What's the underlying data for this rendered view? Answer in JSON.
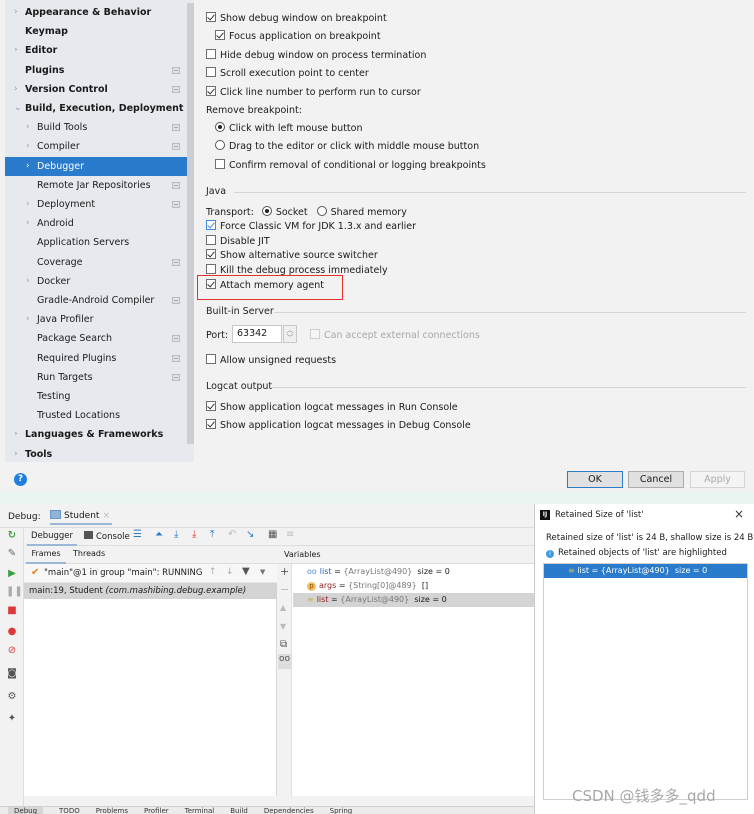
{
  "sidebar": {
    "items": [
      {
        "label": "Appearance & Behavior",
        "chevron": "right",
        "bold": true,
        "page": false
      },
      {
        "label": "Keymap",
        "chevron": "",
        "bold": true,
        "page": false
      },
      {
        "label": "Editor",
        "chevron": "right",
        "bold": true,
        "page": false
      },
      {
        "label": "Plugins",
        "chevron": "",
        "bold": true,
        "page": true
      },
      {
        "label": "Version Control",
        "chevron": "right",
        "bold": true,
        "page": true
      },
      {
        "label": "Build, Execution, Deployment",
        "chevron": "down",
        "bold": true,
        "page": false
      },
      {
        "label": "Build Tools",
        "chevron": "right",
        "bold": false,
        "page": true,
        "indent": 1
      },
      {
        "label": "Compiler",
        "chevron": "right",
        "bold": false,
        "page": true,
        "indent": 1
      },
      {
        "label": "Debugger",
        "chevron": "right",
        "bold": false,
        "page": false,
        "indent": 1,
        "selected": true
      },
      {
        "label": "Remote Jar Repositories",
        "chevron": "",
        "bold": false,
        "page": true,
        "indent": 1
      },
      {
        "label": "Deployment",
        "chevron": "right",
        "bold": false,
        "page": true,
        "indent": 1
      },
      {
        "label": "Android",
        "chevron": "right",
        "bold": false,
        "page": false,
        "indent": 1
      },
      {
        "label": "Application Servers",
        "chevron": "",
        "bold": false,
        "page": false,
        "indent": 1
      },
      {
        "label": "Coverage",
        "chevron": "",
        "bold": false,
        "page": true,
        "indent": 1
      },
      {
        "label": "Docker",
        "chevron": "right",
        "bold": false,
        "page": false,
        "indent": 1
      },
      {
        "label": "Gradle-Android Compiler",
        "chevron": "",
        "bold": false,
        "page": true,
        "indent": 1
      },
      {
        "label": "Java Profiler",
        "chevron": "right",
        "bold": false,
        "page": false,
        "indent": 1
      },
      {
        "label": "Package Search",
        "chevron": "",
        "bold": false,
        "page": true,
        "indent": 1
      },
      {
        "label": "Required Plugins",
        "chevron": "",
        "bold": false,
        "page": true,
        "indent": 1
      },
      {
        "label": "Run Targets",
        "chevron": "",
        "bold": false,
        "page": true,
        "indent": 1
      },
      {
        "label": "Testing",
        "chevron": "",
        "bold": false,
        "page": false,
        "indent": 1
      },
      {
        "label": "Trusted Locations",
        "chevron": "",
        "bold": false,
        "page": false,
        "indent": 1
      },
      {
        "label": "Languages & Frameworks",
        "chevron": "right",
        "bold": true,
        "page": false
      },
      {
        "label": "Tools",
        "chevron": "right",
        "bold": true,
        "page": false
      }
    ]
  },
  "debugger_settings": {
    "show_debug_window": {
      "label": "Show debug window on breakpoint",
      "checked": true
    },
    "focus_app": {
      "label": "Focus application on breakpoint",
      "checked": true
    },
    "hide_debug_window": {
      "label": "Hide debug window on process termination",
      "checked": false
    },
    "scroll_exec": {
      "label": "Scroll execution point to center",
      "checked": false
    },
    "click_line": {
      "label": "Click line number to perform run to cursor",
      "checked": true
    },
    "remove_bp_label": "Remove breakpoint:",
    "remove_click": {
      "label": "Click with left mouse button",
      "selected": true
    },
    "remove_drag": {
      "label": "Drag to the editor or click with middle mouse button",
      "selected": false
    },
    "confirm_removal": {
      "label": "Confirm removal of conditional or logging breakpoints",
      "checked": false
    },
    "java_section": "Java",
    "transport_label": "Transport:",
    "transport_socket": "Socket",
    "transport_shared": "Shared memory",
    "transport_selected": "Socket",
    "force_classic": {
      "label": "Force Classic VM for JDK 1.3.x and earlier",
      "checked": true
    },
    "disable_jit": {
      "label": "Disable JIT",
      "checked": false
    },
    "alt_source": {
      "label": "Show alternative source switcher",
      "checked": true
    },
    "kill_debug": {
      "label": "Kill the debug process immediately",
      "checked": false
    },
    "attach_memory": {
      "label": "Attach memory agent",
      "checked": true
    },
    "server_section": "Built-in Server",
    "port_label": "Port:",
    "port_value": "63342",
    "external_conn": {
      "label": "Can accept external connections",
      "checked": false,
      "disabled": true
    },
    "unsigned": {
      "label": "Allow unsigned requests",
      "checked": false
    },
    "logcat_section": "Logcat output",
    "logcat_run": {
      "label": "Show application logcat messages in Run Console",
      "checked": true
    },
    "logcat_debug": {
      "label": "Show application logcat messages in Debug Console",
      "checked": true
    }
  },
  "dialog_buttons": {
    "ok": "OK",
    "cancel": "Cancel",
    "apply": "Apply"
  },
  "debug": {
    "title": "Debug:",
    "session_tab": "Student",
    "tabs": {
      "debugger": "Debugger",
      "console": "Console"
    },
    "subtabs": {
      "frames": "Frames",
      "threads": "Threads"
    },
    "thread": "\"main\"@1 in group \"main\": RUNNING",
    "frame_location": "main:19, Student",
    "frame_package": "(com.mashibing.debug.example)",
    "variables_header": "Variables",
    "variables": [
      {
        "icon": "watch",
        "name": "list",
        "value": "{ArrayList@490}",
        "extra": "size = 0"
      },
      {
        "icon": "param",
        "name": "args",
        "value": "{String[0]@489}",
        "extra": "[]"
      },
      {
        "icon": "field",
        "name": "list",
        "value": "{ArrayList@490}",
        "extra": "size = 0",
        "selected": true
      }
    ],
    "bottom_tabs": [
      "Debug",
      "TODO",
      "Problems",
      "Profiler",
      "Terminal",
      "Build",
      "Dependencies",
      "Spring"
    ]
  },
  "popup": {
    "title": "Retained Size of 'list'",
    "summary": "Retained size of 'list' is 24 B, shallow size is 24 B",
    "info": "Retained objects of 'list' are highlighted",
    "row": {
      "name": "list",
      "value": "{ArrayList@490}",
      "extra": "size = 0"
    }
  },
  "watermark": "CSDN @钱多多_qdd",
  "colors": {
    "selection": "#2a7bcb",
    "highlight_box": "#e0322e",
    "accent": "#1f7ee0"
  }
}
